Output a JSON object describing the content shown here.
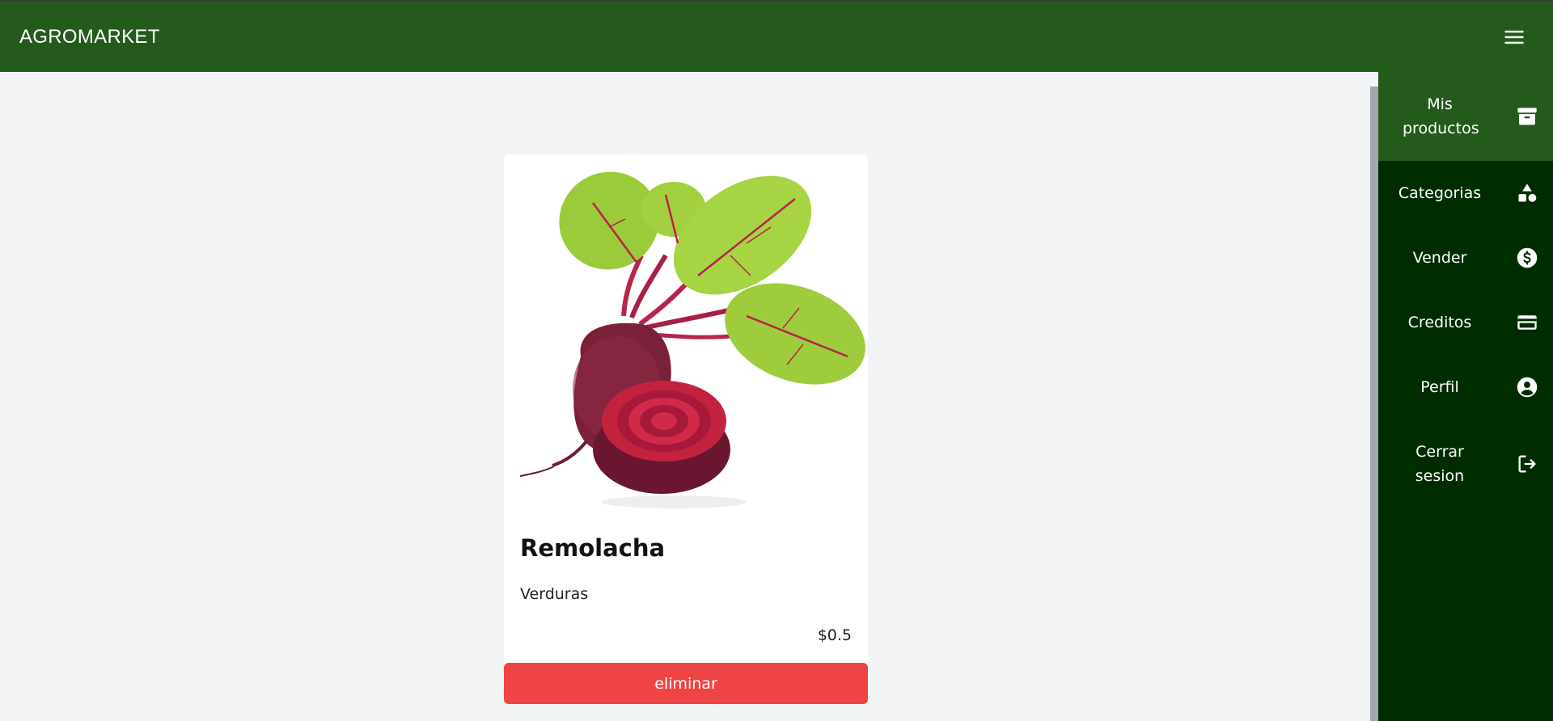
{
  "header": {
    "brand": "AGROMARKET",
    "menu_icon": "hamburger-menu-icon",
    "background": "#245a1c"
  },
  "sidebar": {
    "background": "#002d00",
    "active_background": "#245a1c",
    "items": [
      {
        "label": "Mis productos",
        "icon": "archive-box-icon",
        "active": true
      },
      {
        "label": "Categorias",
        "icon": "shapes-icon",
        "active": false
      },
      {
        "label": "Vender",
        "icon": "dollar-circle-icon",
        "active": false
      },
      {
        "label": "Creditos",
        "icon": "credit-card-icon",
        "active": false
      },
      {
        "label": "Perfil",
        "icon": "user-circle-icon",
        "active": false
      },
      {
        "label": "Cerrar sesion",
        "icon": "logout-icon",
        "active": false
      }
    ]
  },
  "product": {
    "name": "Remolacha",
    "category": "Verduras",
    "price": "$0.5",
    "image": "beetroot-image",
    "delete_label": "eliminar",
    "delete_color": "#ef4444"
  }
}
